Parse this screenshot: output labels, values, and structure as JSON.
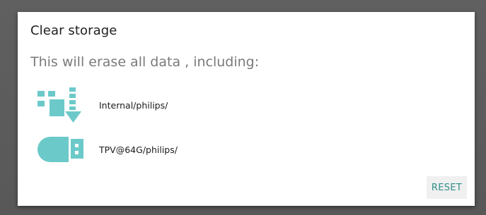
{
  "dialog": {
    "title": "Clear storage",
    "message": "This will erase all data , including:",
    "items": [
      {
        "icon": "internal-storage-icon",
        "label": "Internal/philips/"
      },
      {
        "icon": "usb-drive-icon",
        "label": "TPV@64G/philips/"
      }
    ],
    "reset_label": "RESET"
  },
  "colors": {
    "accent": "#2f8f86",
    "icon": "#6cc9c9"
  }
}
